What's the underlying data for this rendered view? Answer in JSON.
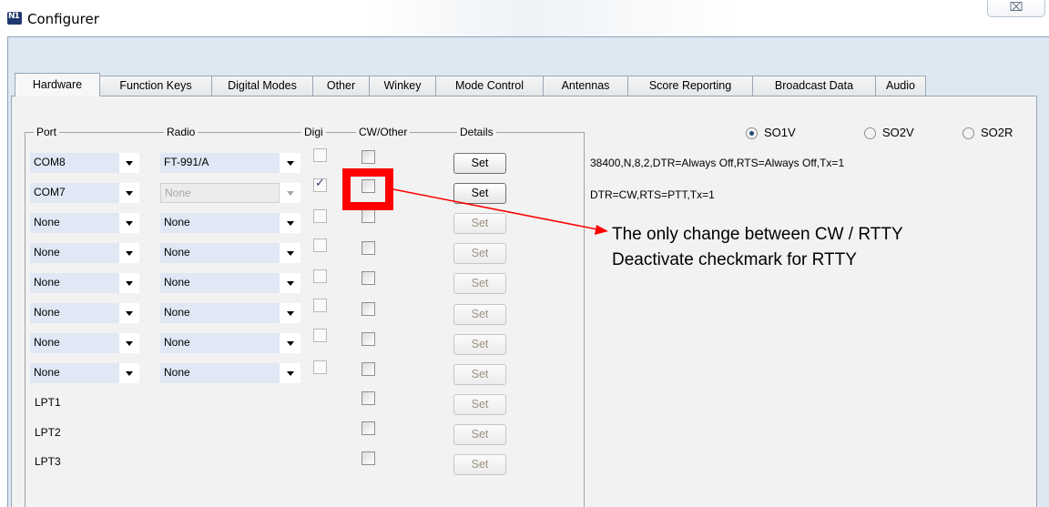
{
  "window": {
    "title": "Configurer",
    "app_logo": "N1",
    "close_glyph": "⌧"
  },
  "tabs": [
    {
      "label": "Hardware",
      "active": true
    },
    {
      "label": "Function Keys"
    },
    {
      "label": "Digital Modes"
    },
    {
      "label": "Other"
    },
    {
      "label": "Winkey"
    },
    {
      "label": "Mode Control"
    },
    {
      "label": "Antennas"
    },
    {
      "label": "Score Reporting"
    },
    {
      "label": "Broadcast Data"
    },
    {
      "label": "Audio"
    }
  ],
  "columns": {
    "port": "Port",
    "radio": "Radio",
    "digi": "Digi",
    "cw_other": "CW/Other",
    "details": "Details"
  },
  "rows": [
    {
      "port": "COM8",
      "radio": "FT-991/A",
      "digi": false,
      "cw": false,
      "set": "Set",
      "set_enabled": true
    },
    {
      "port": "COM7",
      "radio": "None",
      "radio_disabled": true,
      "digi": true,
      "cw": false,
      "set": "Set",
      "set_enabled": true
    },
    {
      "port": "None",
      "radio": "None",
      "digi": false,
      "cw": false,
      "set": "Set"
    },
    {
      "port": "None",
      "radio": "None",
      "digi": false,
      "cw": false,
      "set": "Set"
    },
    {
      "port": "None",
      "radio": "None",
      "digi": false,
      "cw": false,
      "set": "Set"
    },
    {
      "port": "None",
      "radio": "None",
      "digi": false,
      "cw": false,
      "set": "Set"
    },
    {
      "port": "None",
      "radio": "None",
      "digi": false,
      "cw": false,
      "set": "Set"
    },
    {
      "port": "None",
      "radio": "None",
      "digi": false,
      "cw": false,
      "set": "Set"
    }
  ],
  "lpt_rows": [
    {
      "label": "LPT1",
      "cw": false,
      "set": "Set"
    },
    {
      "label": "LPT2",
      "cw": false,
      "set": "Set"
    },
    {
      "label": "LPT3",
      "cw": false,
      "set": "Set"
    }
  ],
  "operating_mode": {
    "options": [
      "SO1V",
      "SO2V",
      "SO2R"
    ],
    "selected": "SO1V"
  },
  "details_text": [
    "38400,N,8,2,DTR=Always Off,RTS=Always Off,Tx=1",
    "DTR=CW,RTS=PTT,Tx=1"
  ],
  "annotation": {
    "line1": "The only change between CW / RTTY",
    "line2": "Deactivate checkmark for RTTY",
    "color": "#ff0000"
  },
  "colors": {
    "frame_bg": "#dde8f3",
    "panel_bg": "#f2f2f2",
    "combo_value_bg": "#dfe8f4",
    "highlight": "#ff0000"
  }
}
